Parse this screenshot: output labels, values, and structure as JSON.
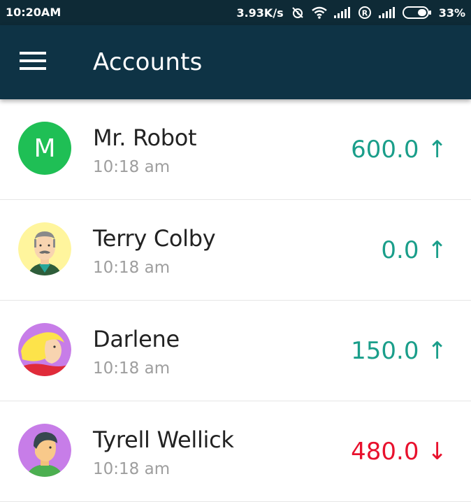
{
  "status_bar": {
    "time": "10:20AM",
    "network_speed": "3.93K/s",
    "battery": "33%",
    "icons": [
      "alarm-off-icon",
      "wifi-icon",
      "signal-icon",
      "roaming-icon",
      "signal-icon",
      "battery-icon"
    ]
  },
  "app_bar": {
    "title": "Accounts",
    "menu_icon": "hamburger-menu-icon"
  },
  "colors": {
    "status_bar": "#0e2a36",
    "app_bar": "#0e3345",
    "positive": "#1a9e8a",
    "negative": "#e8112d",
    "avatar_green": "#1fbf55"
  },
  "accounts": [
    {
      "name": "Mr. Robot",
      "time": "10:18 am",
      "amount": "600.0",
      "trend": "↑",
      "trend_direction": "up",
      "avatar": "letter",
      "avatar_letter": "M"
    },
    {
      "name": "Terry Colby",
      "time": "10:18 am",
      "amount": "0.0",
      "trend": "↑",
      "trend_direction": "up",
      "avatar": "old-man-avatar"
    },
    {
      "name": "Darlene",
      "time": "10:18 am",
      "amount": "150.0",
      "trend": "↑",
      "trend_direction": "up",
      "avatar": "blonde-woman-avatar"
    },
    {
      "name": "Tyrell Wellick",
      "time": "10:18 am",
      "amount": "480.0",
      "trend": "↓",
      "trend_direction": "down",
      "avatar": "man-avatar"
    }
  ]
}
